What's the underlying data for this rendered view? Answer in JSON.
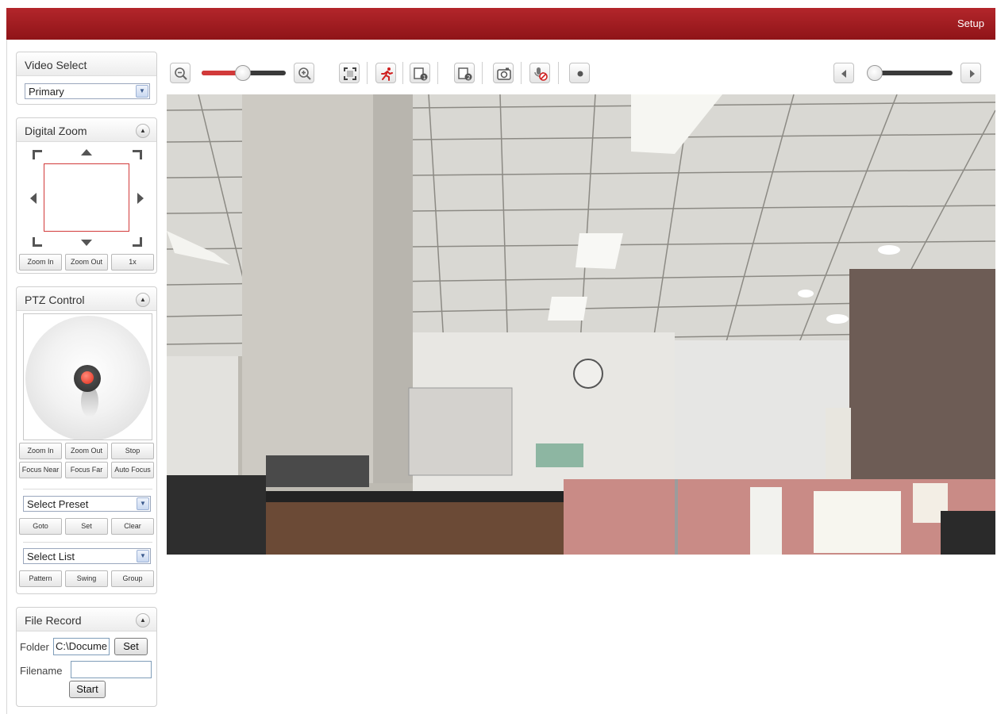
{
  "header": {
    "setup_label": "Setup"
  },
  "video_select": {
    "title": "Video Select",
    "selected": "Primary"
  },
  "digital_zoom": {
    "title": "Digital Zoom",
    "buttons": {
      "zoom_in": "Zoom In",
      "zoom_out": "Zoom Out",
      "reset": "1x"
    }
  },
  "ptz_control": {
    "title": "PTZ Control",
    "buttons": {
      "zoom_in": "Zoom In",
      "zoom_out": "Zoom Out",
      "stop": "Stop",
      "focus_near": "Focus Near",
      "focus_far": "Focus Far",
      "auto_focus": "Auto Focus"
    },
    "preset": {
      "selected": "Select Preset",
      "goto": "Goto",
      "set": "Set",
      "clear": "Clear"
    },
    "list": {
      "selected": "Select List",
      "pattern": "Pattern",
      "swing": "Swing",
      "group": "Group"
    }
  },
  "file_record": {
    "title": "File Record",
    "folder_label": "Folder",
    "folder_value": "C:\\Docume",
    "set_label": "Set",
    "filename_label": "Filename",
    "filename_value": "",
    "start_label": "Start"
  },
  "toolbar": {
    "icons": [
      "zoom-out-icon",
      "zoom-in-icon",
      "fullscreen-icon",
      "motion-detect-icon",
      "alarm-out-1-icon",
      "alarm-out-2-icon",
      "snapshot-icon",
      "audio-mute-icon",
      "record-icon",
      "previous-icon",
      "next-icon"
    ],
    "zoom_slider_level": 0.45,
    "playback_slider_level": 0.05
  },
  "colors": {
    "header_red": "#a11d22",
    "accent_red": "#d23a3a"
  }
}
